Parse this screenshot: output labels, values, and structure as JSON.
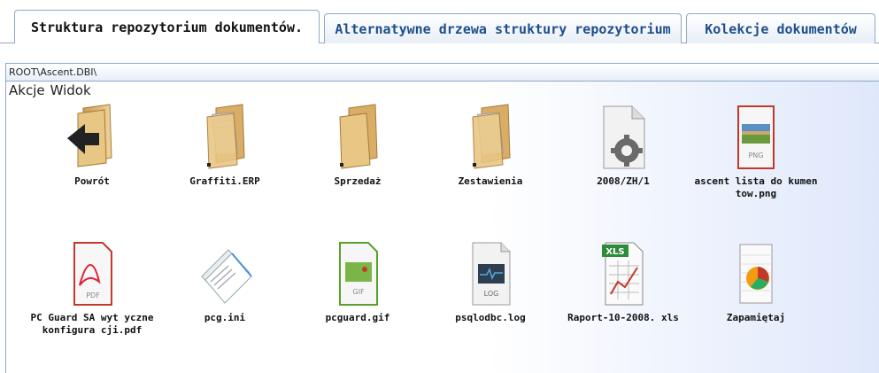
{
  "tabs": [
    {
      "label": "Struktura repozytorium dokumentów."
    },
    {
      "label": "Alternatywne drzewa struktury repozytorium"
    },
    {
      "label": "Kolekcje dokumentów"
    }
  ],
  "path": "ROOT\\Ascent.DBI\\",
  "menu": {
    "actions": "Akcje",
    "view": "Widok"
  },
  "items": [
    {
      "label": "Powrót",
      "icon": "folder-back-icon"
    },
    {
      "label": "Graffiti.ERP",
      "icon": "folder-icon"
    },
    {
      "label": "Sprzedaż",
      "icon": "folder-icon"
    },
    {
      "label": "Zestawienia",
      "icon": "folder-icon"
    },
    {
      "label": "2008/ZH/1",
      "icon": "settings-file-icon"
    },
    {
      "label": "ascent lista do kumentow.png",
      "icon": "png-file-icon",
      "badge": "PNG"
    },
    {
      "label": "PC Guard SA wyt yczne konfigura cji.pdf",
      "icon": "pdf-file-icon",
      "badge": "PDF"
    },
    {
      "label": "pcg.ini",
      "icon": "ini-file-icon"
    },
    {
      "label": "pcguard.gif",
      "icon": "gif-file-icon",
      "badge": "GIF"
    },
    {
      "label": "psqlodbc.log",
      "icon": "log-file-icon",
      "badge": "LOG"
    },
    {
      "label": "Raport-10-2008. xls",
      "icon": "xls-file-icon",
      "badge": "XLS"
    },
    {
      "label": "Zapamiętaj",
      "icon": "save-view-icon"
    }
  ]
}
